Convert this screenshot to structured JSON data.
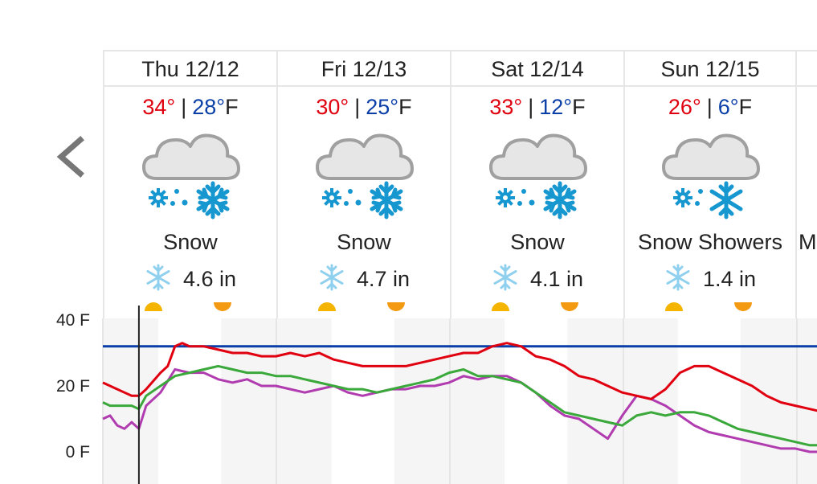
{
  "nav": {
    "prev_icon": "chevron-left-icon"
  },
  "days": [
    {
      "date": "Thu 12/12",
      "high": "34°",
      "low": "28°",
      "unit": "F",
      "separator": "|",
      "icon": "snow-icon",
      "condition": "Snow",
      "snow": "4.6 in"
    },
    {
      "date": "Fri 12/13",
      "high": "30°",
      "low": "25°",
      "unit": "F",
      "separator": "|",
      "icon": "snow-icon",
      "condition": "Snow",
      "snow": "4.7 in"
    },
    {
      "date": "Sat 12/14",
      "high": "33°",
      "low": "12°",
      "unit": "F",
      "separator": "|",
      "icon": "snow-icon",
      "condition": "Snow",
      "snow": "4.1 in"
    },
    {
      "date": "Sun 12/15",
      "high": "26°",
      "low": "6°",
      "unit": "F",
      "separator": "|",
      "icon": "snow-shower-icon",
      "condition": "Snow Showers",
      "snow": "1.4 in"
    }
  ],
  "partial_next_day_condition": "M",
  "colors": {
    "high": "#e0000f",
    "low": "#0b3fa8",
    "freezing_line": "#0b3fa8",
    "temperature": "#e0000f",
    "feels_like": "#3aa83a",
    "dew_point": "#b03cb0",
    "sunrise": "#f5b400",
    "sunset": "#f39a12"
  },
  "chart_data": {
    "type": "line",
    "y_tick_labels": [
      "40 F",
      "20 F",
      "0 F"
    ],
    "y_ticks": [
      40,
      20,
      0
    ],
    "ylim": [
      -8,
      44
    ],
    "x_unit": "hours since Thu 12/12 00:00",
    "xlim": [
      0,
      102
    ],
    "freezing_line": 32,
    "current_time_marker": 5,
    "series": [
      {
        "key": "temperature",
        "x": [
          0,
          2,
          3,
          4,
          5,
          6,
          8,
          9,
          10,
          11,
          12,
          14,
          16,
          18,
          20,
          22,
          24,
          26,
          28,
          30,
          32,
          34,
          36,
          38,
          40,
          42,
          44,
          46,
          48,
          50,
          52,
          54,
          56,
          58,
          60,
          62,
          64,
          66,
          68,
          70,
          72,
          74,
          76,
          78,
          80,
          82,
          84,
          86,
          88,
          90,
          92,
          94,
          96,
          98,
          100,
          102
        ],
        "y": [
          21,
          19,
          18,
          17,
          17,
          19,
          24,
          26,
          32,
          33,
          32,
          32,
          31,
          30,
          30,
          29,
          29,
          30,
          29,
          30,
          28,
          27,
          26,
          26,
          26,
          26,
          27,
          28,
          29,
          30,
          30,
          32,
          33,
          32,
          29,
          28,
          26,
          23,
          22,
          20,
          18,
          17,
          16,
          19,
          24,
          26,
          26,
          24,
          22,
          20,
          17,
          15,
          14,
          13,
          12,
          11
        ]
      },
      {
        "key": "feels_like",
        "x": [
          0,
          1,
          2,
          4,
          5,
          6,
          8,
          10,
          12,
          14,
          16,
          18,
          20,
          22,
          24,
          26,
          28,
          30,
          32,
          34,
          36,
          38,
          40,
          42,
          44,
          46,
          48,
          50,
          52,
          54,
          56,
          58,
          60,
          62,
          64,
          66,
          68,
          70,
          72,
          74,
          76,
          78,
          80,
          82,
          84,
          86,
          88,
          90,
          92,
          94,
          96,
          98,
          100,
          102
        ],
        "y": [
          15,
          14,
          14,
          14,
          13,
          17,
          20,
          23,
          24,
          25,
          26,
          25,
          24,
          24,
          23,
          23,
          22,
          21,
          20,
          19,
          19,
          18,
          19,
          20,
          21,
          22,
          24,
          25,
          23,
          23,
          22,
          21,
          18,
          15,
          12,
          11,
          10,
          9,
          8,
          11,
          12,
          11,
          12,
          12,
          11,
          9,
          7,
          6,
          5,
          4,
          3,
          2,
          2,
          2
        ]
      },
      {
        "key": "dew_point",
        "x": [
          0,
          1,
          2,
          3,
          4,
          5,
          6,
          8,
          10,
          12,
          14,
          16,
          18,
          20,
          22,
          24,
          26,
          28,
          30,
          32,
          34,
          36,
          38,
          40,
          42,
          44,
          46,
          48,
          50,
          52,
          54,
          56,
          58,
          60,
          62,
          64,
          66,
          68,
          70,
          72,
          74,
          76,
          78,
          80,
          82,
          84,
          86,
          88,
          90,
          92,
          94,
          96,
          98,
          100,
          102
        ],
        "y": [
          10,
          11,
          8,
          7,
          9,
          7,
          14,
          18,
          25,
          24,
          24,
          22,
          21,
          22,
          20,
          20,
          19,
          18,
          19,
          20,
          18,
          17,
          18,
          19,
          19,
          20,
          20,
          21,
          23,
          22,
          23,
          23,
          21,
          18,
          14,
          11,
          10,
          7,
          4,
          11,
          17,
          16,
          14,
          11,
          8,
          6,
          5,
          4,
          3,
          2,
          1,
          1,
          0,
          0,
          -1
        ]
      }
    ]
  }
}
